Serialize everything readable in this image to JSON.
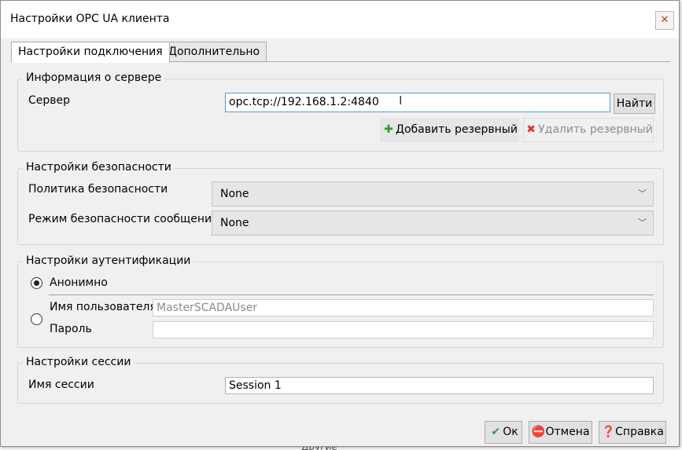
{
  "window": {
    "title": "Настройки OPC UA клиента"
  },
  "tabs": [
    {
      "label": "Настройки подключения",
      "active": true
    },
    {
      "label": "Дополнительно",
      "active": false
    }
  ],
  "server_group": {
    "title": "Информация о сервере",
    "server_label": "Сервер",
    "server_value": "opc.tcp://192.168.1.2:4840",
    "find_button": "Найти",
    "add_backup_button": "Добавить резервный",
    "remove_backup_button": "Удалить резервный"
  },
  "security_group": {
    "title": "Настройки безопасности",
    "policy_label": "Политика безопасности",
    "policy_value": "None",
    "mode_label": "Режим безопасности сообщений",
    "mode_value": "None"
  },
  "auth_group": {
    "title": "Настройки аутентификации",
    "anonymous_label": "Анонимно",
    "anonymous_selected": true,
    "username_label": "Имя пользователя",
    "username_value": "MasterSCADAUser",
    "password_label": "Пароль",
    "password_value": ""
  },
  "session_group": {
    "title": "Настройки сессии",
    "session_name_label": "Имя сессии",
    "session_name_value": "Session 1"
  },
  "footer": {
    "ok_label": "Ок",
    "cancel_label": "Отмена",
    "help_label": "Справка"
  },
  "background": {
    "partial_text": "Другие"
  },
  "icons": {
    "close": "close-icon",
    "add": "plus-icon",
    "remove": "x-icon",
    "ok": "checkmark-icon",
    "cancel": "no-entry-icon",
    "help": "help-icon"
  },
  "colors": {
    "dialog_bg": "#f0f0f0",
    "focus_border": "#5b9bd5",
    "add_icon": "#2e9e2e",
    "remove_icon": "#d93b3b",
    "ok_icon": "#2e9e2e",
    "cancel_icon": "#c0392b",
    "help_icon": "#2f6db5"
  }
}
